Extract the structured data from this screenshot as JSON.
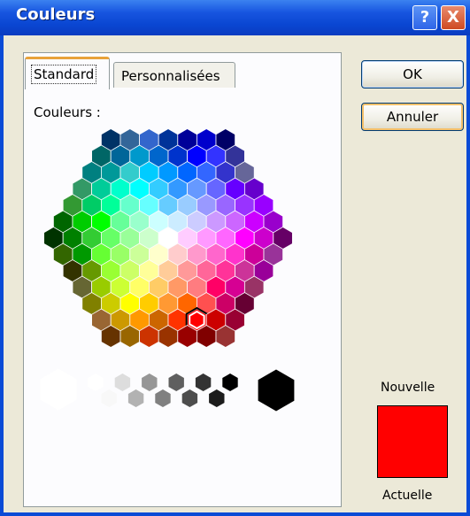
{
  "window": {
    "title": "Couleurs",
    "help_glyph": "?",
    "close_glyph": "X"
  },
  "tabs": [
    {
      "label": "Standard",
      "active": true
    },
    {
      "label": "Personnalisées",
      "active": false
    }
  ],
  "colors_label": "Couleurs :",
  "buttons": {
    "ok": "OK",
    "cancel": "Annuler"
  },
  "preview": {
    "new_label": "Nouvelle",
    "current_label": "Actuelle",
    "new_color": "#ff0000",
    "current_color": "#ff0000"
  },
  "selected_color": "#ff0000",
  "hex_rows": [
    [
      "#003366",
      "#336699",
      "#3366cc",
      "#003399",
      "#000099",
      "#0000cc",
      "#000066"
    ],
    [
      "#006666",
      "#006699",
      "#0099cc",
      "#0066cc",
      "#0033cc",
      "#0000ff",
      "#3333ff",
      "#333399"
    ],
    [
      "#008080",
      "#009999",
      "#33cccc",
      "#00ccff",
      "#0099ff",
      "#0066ff",
      "#3366ff",
      "#3333cc",
      "#666699"
    ],
    [
      "#339966",
      "#00cc99",
      "#00ffcc",
      "#00ffff",
      "#33ccff",
      "#3399ff",
      "#6699ff",
      "#6666ff",
      "#6600ff",
      "#6600cc"
    ],
    [
      "#339933",
      "#00cc66",
      "#00ff99",
      "#66ffcc",
      "#66ffff",
      "#66ccff",
      "#99ccff",
      "#9999ff",
      "#9966ff",
      "#9933ff",
      "#9900ff"
    ],
    [
      "#006600",
      "#00cc00",
      "#00ff00",
      "#66ff99",
      "#99ffcc",
      "#ccffff",
      "#ccecff",
      "#ccccff",
      "#cc99ff",
      "#cc66ff",
      "#cc00ff",
      "#9900cc"
    ],
    [
      "#003300",
      "#008000",
      "#33cc33",
      "#66ff66",
      "#99ff99",
      "#ccffcc",
      "#ffffff",
      "#ffccff",
      "#ff99ff",
      "#ff66ff",
      "#ff00ff",
      "#cc00cc",
      "#660066"
    ],
    [
      "#336600",
      "#009900",
      "#66ff33",
      "#99ff66",
      "#ccff99",
      "#ffffcc",
      "#ffcccc",
      "#ff99cc",
      "#ff66cc",
      "#ff33cc",
      "#cc0099",
      "#993399"
    ],
    [
      "#333300",
      "#669900",
      "#99ff33",
      "#ccff66",
      "#ffff99",
      "#ffcc99",
      "#ff9999",
      "#ff6699",
      "#ff3399",
      "#cc3399",
      "#990099"
    ],
    [
      "#666633",
      "#99cc00",
      "#ccff33",
      "#ffff66",
      "#ffcc66",
      "#ff9966",
      "#ff7c80",
      "#ff0066",
      "#d60093",
      "#993366"
    ],
    [
      "#808000",
      "#cccc00",
      "#ffff00",
      "#ffcc00",
      "#ff9933",
      "#ff6600",
      "#ff5050",
      "#cc0066",
      "#660033"
    ],
    [
      "#996633",
      "#cc9900",
      "#ff9900",
      "#cc6600",
      "#ff3300",
      "#ff0000",
      "#cc0000",
      "#990033"
    ],
    [
      "#663300",
      "#996600",
      "#cc3300",
      "#993300",
      "#990000",
      "#800000",
      "#993333"
    ]
  ],
  "gray_row": [
    "#ffffff",
    "#f8f8f8",
    "#dddddd",
    "#b2b2b2",
    "#969696",
    "#808080",
    "#5f5f5f",
    "#4d4d4d",
    "#333333",
    "#1c1c1c",
    "#000000"
  ],
  "large_white": "#ffffff",
  "large_black": "#000000"
}
